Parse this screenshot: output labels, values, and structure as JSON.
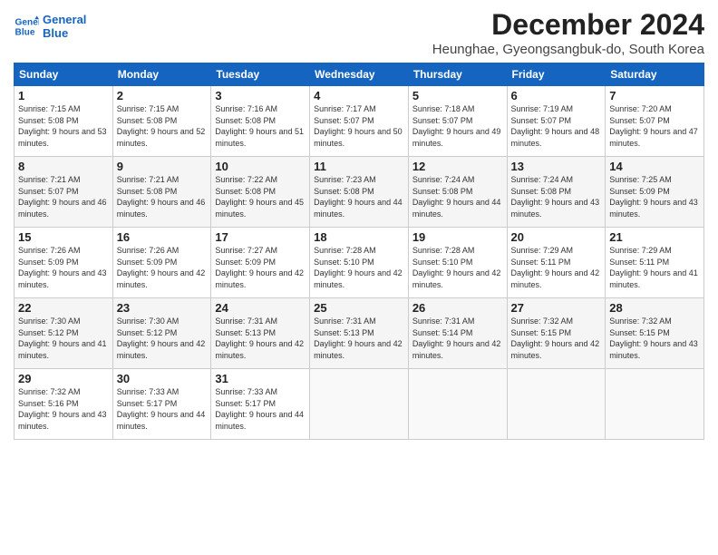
{
  "header": {
    "month_year": "December 2024",
    "location": "Heunghae, Gyeongsangbuk-do, South Korea",
    "logo_line1": "General",
    "logo_line2": "Blue"
  },
  "weekdays": [
    "Sunday",
    "Monday",
    "Tuesday",
    "Wednesday",
    "Thursday",
    "Friday",
    "Saturday"
  ],
  "weeks": [
    [
      {
        "day": "1",
        "sunrise": "7:15 AM",
        "sunset": "5:08 PM",
        "daylight": "9 hours and 53 minutes."
      },
      {
        "day": "2",
        "sunrise": "7:15 AM",
        "sunset": "5:08 PM",
        "daylight": "9 hours and 52 minutes."
      },
      {
        "day": "3",
        "sunrise": "7:16 AM",
        "sunset": "5:08 PM",
        "daylight": "9 hours and 51 minutes."
      },
      {
        "day": "4",
        "sunrise": "7:17 AM",
        "sunset": "5:07 PM",
        "daylight": "9 hours and 50 minutes."
      },
      {
        "day": "5",
        "sunrise": "7:18 AM",
        "sunset": "5:07 PM",
        "daylight": "9 hours and 49 minutes."
      },
      {
        "day": "6",
        "sunrise": "7:19 AM",
        "sunset": "5:07 PM",
        "daylight": "9 hours and 48 minutes."
      },
      {
        "day": "7",
        "sunrise": "7:20 AM",
        "sunset": "5:07 PM",
        "daylight": "9 hours and 47 minutes."
      }
    ],
    [
      {
        "day": "8",
        "sunrise": "7:21 AM",
        "sunset": "5:07 PM",
        "daylight": "9 hours and 46 minutes."
      },
      {
        "day": "9",
        "sunrise": "7:21 AM",
        "sunset": "5:08 PM",
        "daylight": "9 hours and 46 minutes."
      },
      {
        "day": "10",
        "sunrise": "7:22 AM",
        "sunset": "5:08 PM",
        "daylight": "9 hours and 45 minutes."
      },
      {
        "day": "11",
        "sunrise": "7:23 AM",
        "sunset": "5:08 PM",
        "daylight": "9 hours and 44 minutes."
      },
      {
        "day": "12",
        "sunrise": "7:24 AM",
        "sunset": "5:08 PM",
        "daylight": "9 hours and 44 minutes."
      },
      {
        "day": "13",
        "sunrise": "7:24 AM",
        "sunset": "5:08 PM",
        "daylight": "9 hours and 43 minutes."
      },
      {
        "day": "14",
        "sunrise": "7:25 AM",
        "sunset": "5:09 PM",
        "daylight": "9 hours and 43 minutes."
      }
    ],
    [
      {
        "day": "15",
        "sunrise": "7:26 AM",
        "sunset": "5:09 PM",
        "daylight": "9 hours and 43 minutes."
      },
      {
        "day": "16",
        "sunrise": "7:26 AM",
        "sunset": "5:09 PM",
        "daylight": "9 hours and 42 minutes."
      },
      {
        "day": "17",
        "sunrise": "7:27 AM",
        "sunset": "5:09 PM",
        "daylight": "9 hours and 42 minutes."
      },
      {
        "day": "18",
        "sunrise": "7:28 AM",
        "sunset": "5:10 PM",
        "daylight": "9 hours and 42 minutes."
      },
      {
        "day": "19",
        "sunrise": "7:28 AM",
        "sunset": "5:10 PM",
        "daylight": "9 hours and 42 minutes."
      },
      {
        "day": "20",
        "sunrise": "7:29 AM",
        "sunset": "5:11 PM",
        "daylight": "9 hours and 42 minutes."
      },
      {
        "day": "21",
        "sunrise": "7:29 AM",
        "sunset": "5:11 PM",
        "daylight": "9 hours and 41 minutes."
      }
    ],
    [
      {
        "day": "22",
        "sunrise": "7:30 AM",
        "sunset": "5:12 PM",
        "daylight": "9 hours and 41 minutes."
      },
      {
        "day": "23",
        "sunrise": "7:30 AM",
        "sunset": "5:12 PM",
        "daylight": "9 hours and 42 minutes."
      },
      {
        "day": "24",
        "sunrise": "7:31 AM",
        "sunset": "5:13 PM",
        "daylight": "9 hours and 42 minutes."
      },
      {
        "day": "25",
        "sunrise": "7:31 AM",
        "sunset": "5:13 PM",
        "daylight": "9 hours and 42 minutes."
      },
      {
        "day": "26",
        "sunrise": "7:31 AM",
        "sunset": "5:14 PM",
        "daylight": "9 hours and 42 minutes."
      },
      {
        "day": "27",
        "sunrise": "7:32 AM",
        "sunset": "5:15 PM",
        "daylight": "9 hours and 42 minutes."
      },
      {
        "day": "28",
        "sunrise": "7:32 AM",
        "sunset": "5:15 PM",
        "daylight": "9 hours and 43 minutes."
      }
    ],
    [
      {
        "day": "29",
        "sunrise": "7:32 AM",
        "sunset": "5:16 PM",
        "daylight": "9 hours and 43 minutes."
      },
      {
        "day": "30",
        "sunrise": "7:33 AM",
        "sunset": "5:17 PM",
        "daylight": "9 hours and 44 minutes."
      },
      {
        "day": "31",
        "sunrise": "7:33 AM",
        "sunset": "5:17 PM",
        "daylight": "9 hours and 44 minutes."
      },
      null,
      null,
      null,
      null
    ]
  ]
}
